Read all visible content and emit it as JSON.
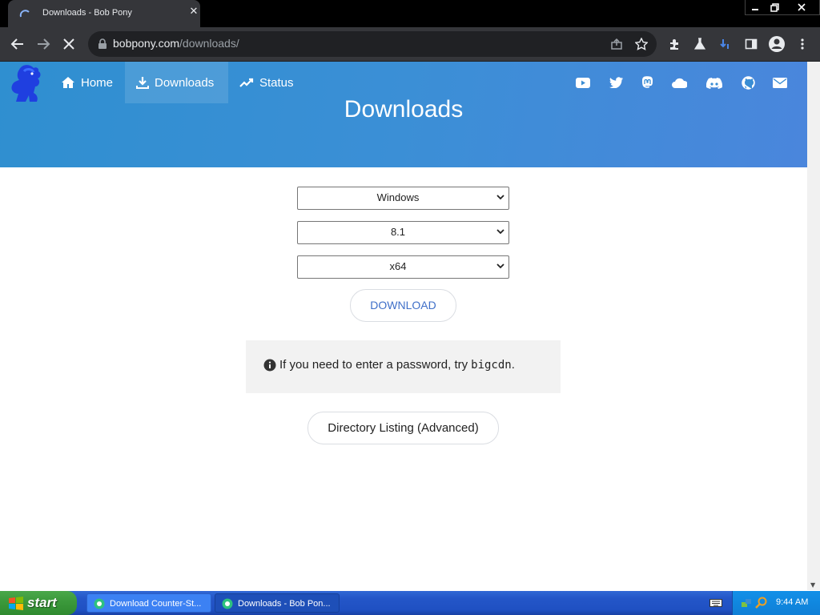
{
  "browser": {
    "tab_title": "Downloads - Bob Pony",
    "tab_close": "✕",
    "url_domain": "bobpony.com",
    "url_path": "/downloads/"
  },
  "site": {
    "nav": [
      {
        "label": "Home",
        "icon": "home-icon"
      },
      {
        "label": "Downloads",
        "icon": "download-icon"
      },
      {
        "label": "Status",
        "icon": "trending-up-icon"
      }
    ],
    "social_icons": [
      "youtube-icon",
      "twitter-icon",
      "mastodon-icon",
      "cloud-icon",
      "discord-icon",
      "github-icon",
      "mail-icon"
    ],
    "page_title": "Downloads",
    "header_colors": [
      "#2f8fd0",
      "#4a86dc"
    ]
  },
  "form": {
    "os": "Windows",
    "version": "8.1",
    "arch": "x64",
    "download_label": "DOWNLOAD",
    "notice_text": "If you need to enter a password, try",
    "notice_code": "bigcdn",
    "notice_end": ".",
    "directory_label": "Directory Listing (Advanced)"
  },
  "taskbar": {
    "start_label": "start",
    "items": [
      {
        "label": "Download Counter-St..."
      },
      {
        "label": "Downloads - Bob Pon..."
      }
    ],
    "clock": "9:44 AM"
  }
}
